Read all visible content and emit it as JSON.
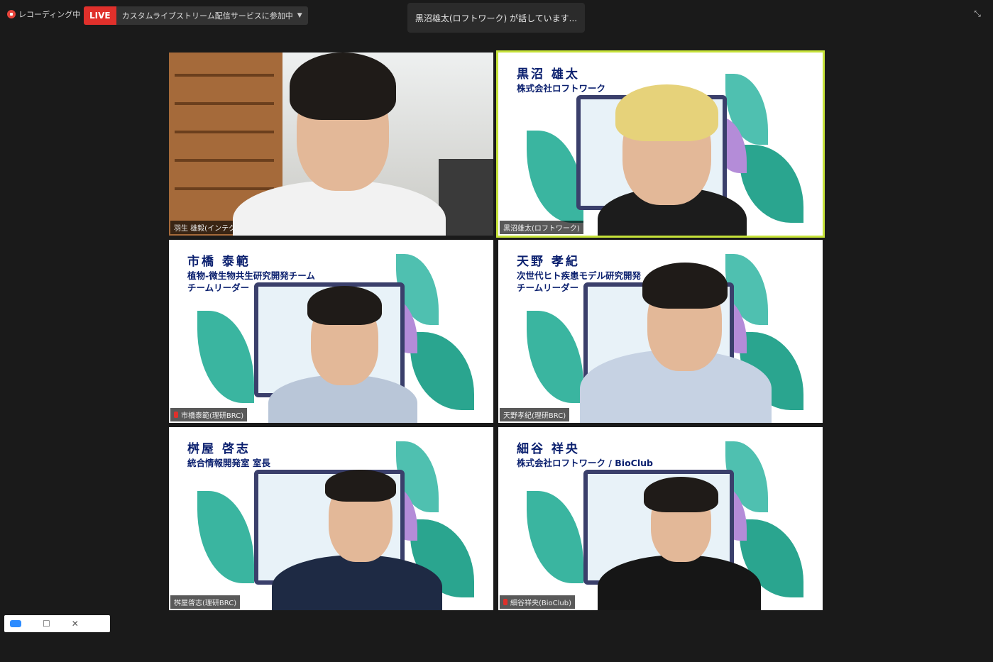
{
  "topbar": {
    "recording_label": "レコーディング中",
    "live_badge": "LIVE",
    "live_service": "カスタムライブストリーム配信サービスに参加中",
    "speaking_text": "黒沼雄太(ロフトワーク) が話しています..."
  },
  "tiles": [
    {
      "label": "羽生 雄毅(インテグリカルチャー)",
      "overlay_name": "",
      "overlay_lines": []
    },
    {
      "label": "黒沼雄太(ロフトワーク)",
      "overlay_name": "黒沼 雄太",
      "overlay_lines": [
        "株式会社ロフトワーク"
      ]
    },
    {
      "label": "市橋泰範(理研BRC)",
      "overlay_name": "市橋 泰範",
      "overlay_lines": [
        "植物-微生物共生研究開発チーム",
        "チームリーダー"
      ]
    },
    {
      "label": "天野孝紀(理研BRC)",
      "overlay_name": "天野 孝紀",
      "overlay_lines": [
        "次世代ヒト疾患モデル研究開発",
        "チームリーダー"
      ]
    },
    {
      "label": "桝屋啓志(理研BRC)",
      "overlay_name": "桝屋 啓志",
      "overlay_lines": [
        "統合情報開発室 室長"
      ]
    },
    {
      "label": "細谷祥央(BioClub)",
      "overlay_name": "細谷 祥央",
      "overlay_lines": [
        "株式会社ロフトワーク / BioClub"
      ]
    }
  ],
  "colors": {
    "live": "#e0302b",
    "active_speaker": "#c6e23a",
    "overlay_text": "#0a1f6e"
  },
  "icons": [
    "record-icon",
    "caret-down-icon",
    "exit-fullscreen-icon",
    "mic-muted-icon",
    "zoom-logo-icon",
    "restore-icon",
    "close-icon"
  ]
}
